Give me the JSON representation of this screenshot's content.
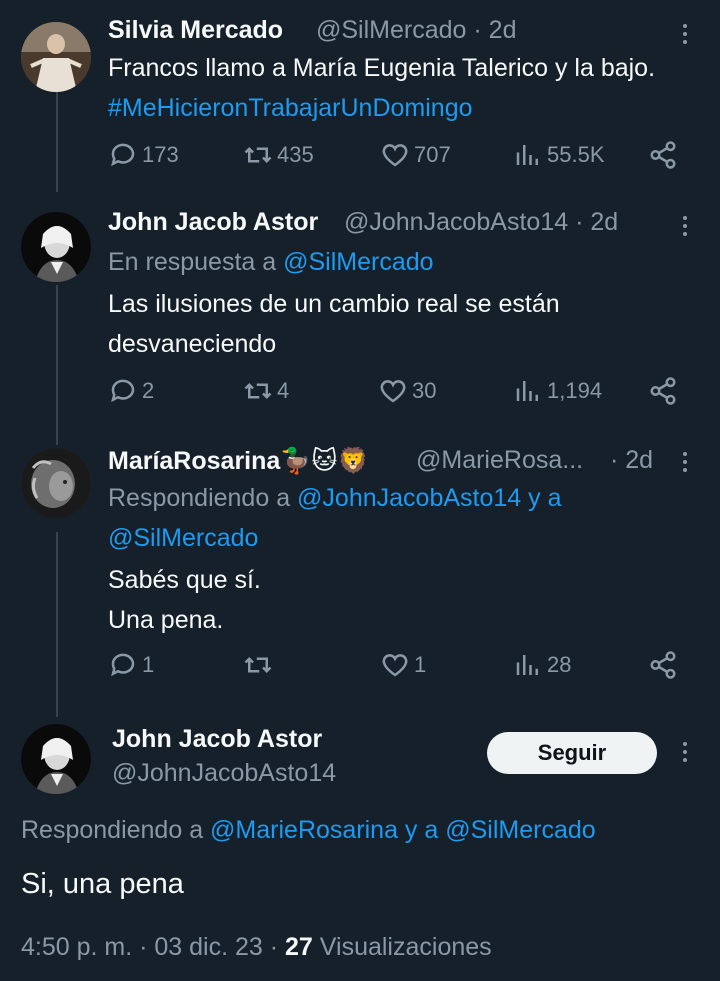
{
  "tweets": [
    {
      "name": "Silvia Mercado",
      "handle": "@SilMercado",
      "time": "· 2d",
      "text": "Francos llamo a María Eugenia Talerico y la bajo.",
      "hashtag": "#MeHicieronTrabajarUnDomingo",
      "replies": "173",
      "retweets": "435",
      "likes": "707",
      "views": "55.5K"
    },
    {
      "name": "John Jacob Astor",
      "handle": "@JohnJacobAsto14",
      "time": "· 2d",
      "reply_prefix": "En respuesta a",
      "reply_to": "@SilMercado",
      "line1": "Las ilusiones de un cambio real se están",
      "line2": "desvaneciendo",
      "replies": "2",
      "retweets": "4",
      "likes": "30",
      "views": "1,194"
    },
    {
      "name": "MaríaRosarina🦆🐱🦁",
      "handle": "@MarieRosa...",
      "time": "· 2d",
      "reply_prefix": "Respondiendo a",
      "reply_to_1": "@JohnJacobAsto14 y a",
      "reply_to_2": "@SilMercado",
      "line1": "Sabés que sí.",
      "line2": "Una pena.",
      "replies": "1",
      "retweets": "",
      "likes": "1",
      "views": "28"
    }
  ],
  "main": {
    "name": "John Jacob Astor",
    "handle": "@JohnJacobAsto14",
    "follow_label": "Seguir",
    "reply_prefix": "Respondiendo a",
    "reply_to": "@MarieRosarina y a @SilMercado",
    "text": "Si, una pena",
    "time": "4:50 p. m. · 03 dic. 23 ·",
    "views_count": "27",
    "views_label": "Visualizaciones"
  },
  "icons": [
    "reply-icon",
    "retweet-icon",
    "like-icon",
    "views-icon",
    "share-icon",
    "more-icon"
  ],
  "colors": {
    "background": "#15202b",
    "link": "#1d9bf0",
    "muted": "#8b98a5",
    "text": "#f7f9f9"
  }
}
